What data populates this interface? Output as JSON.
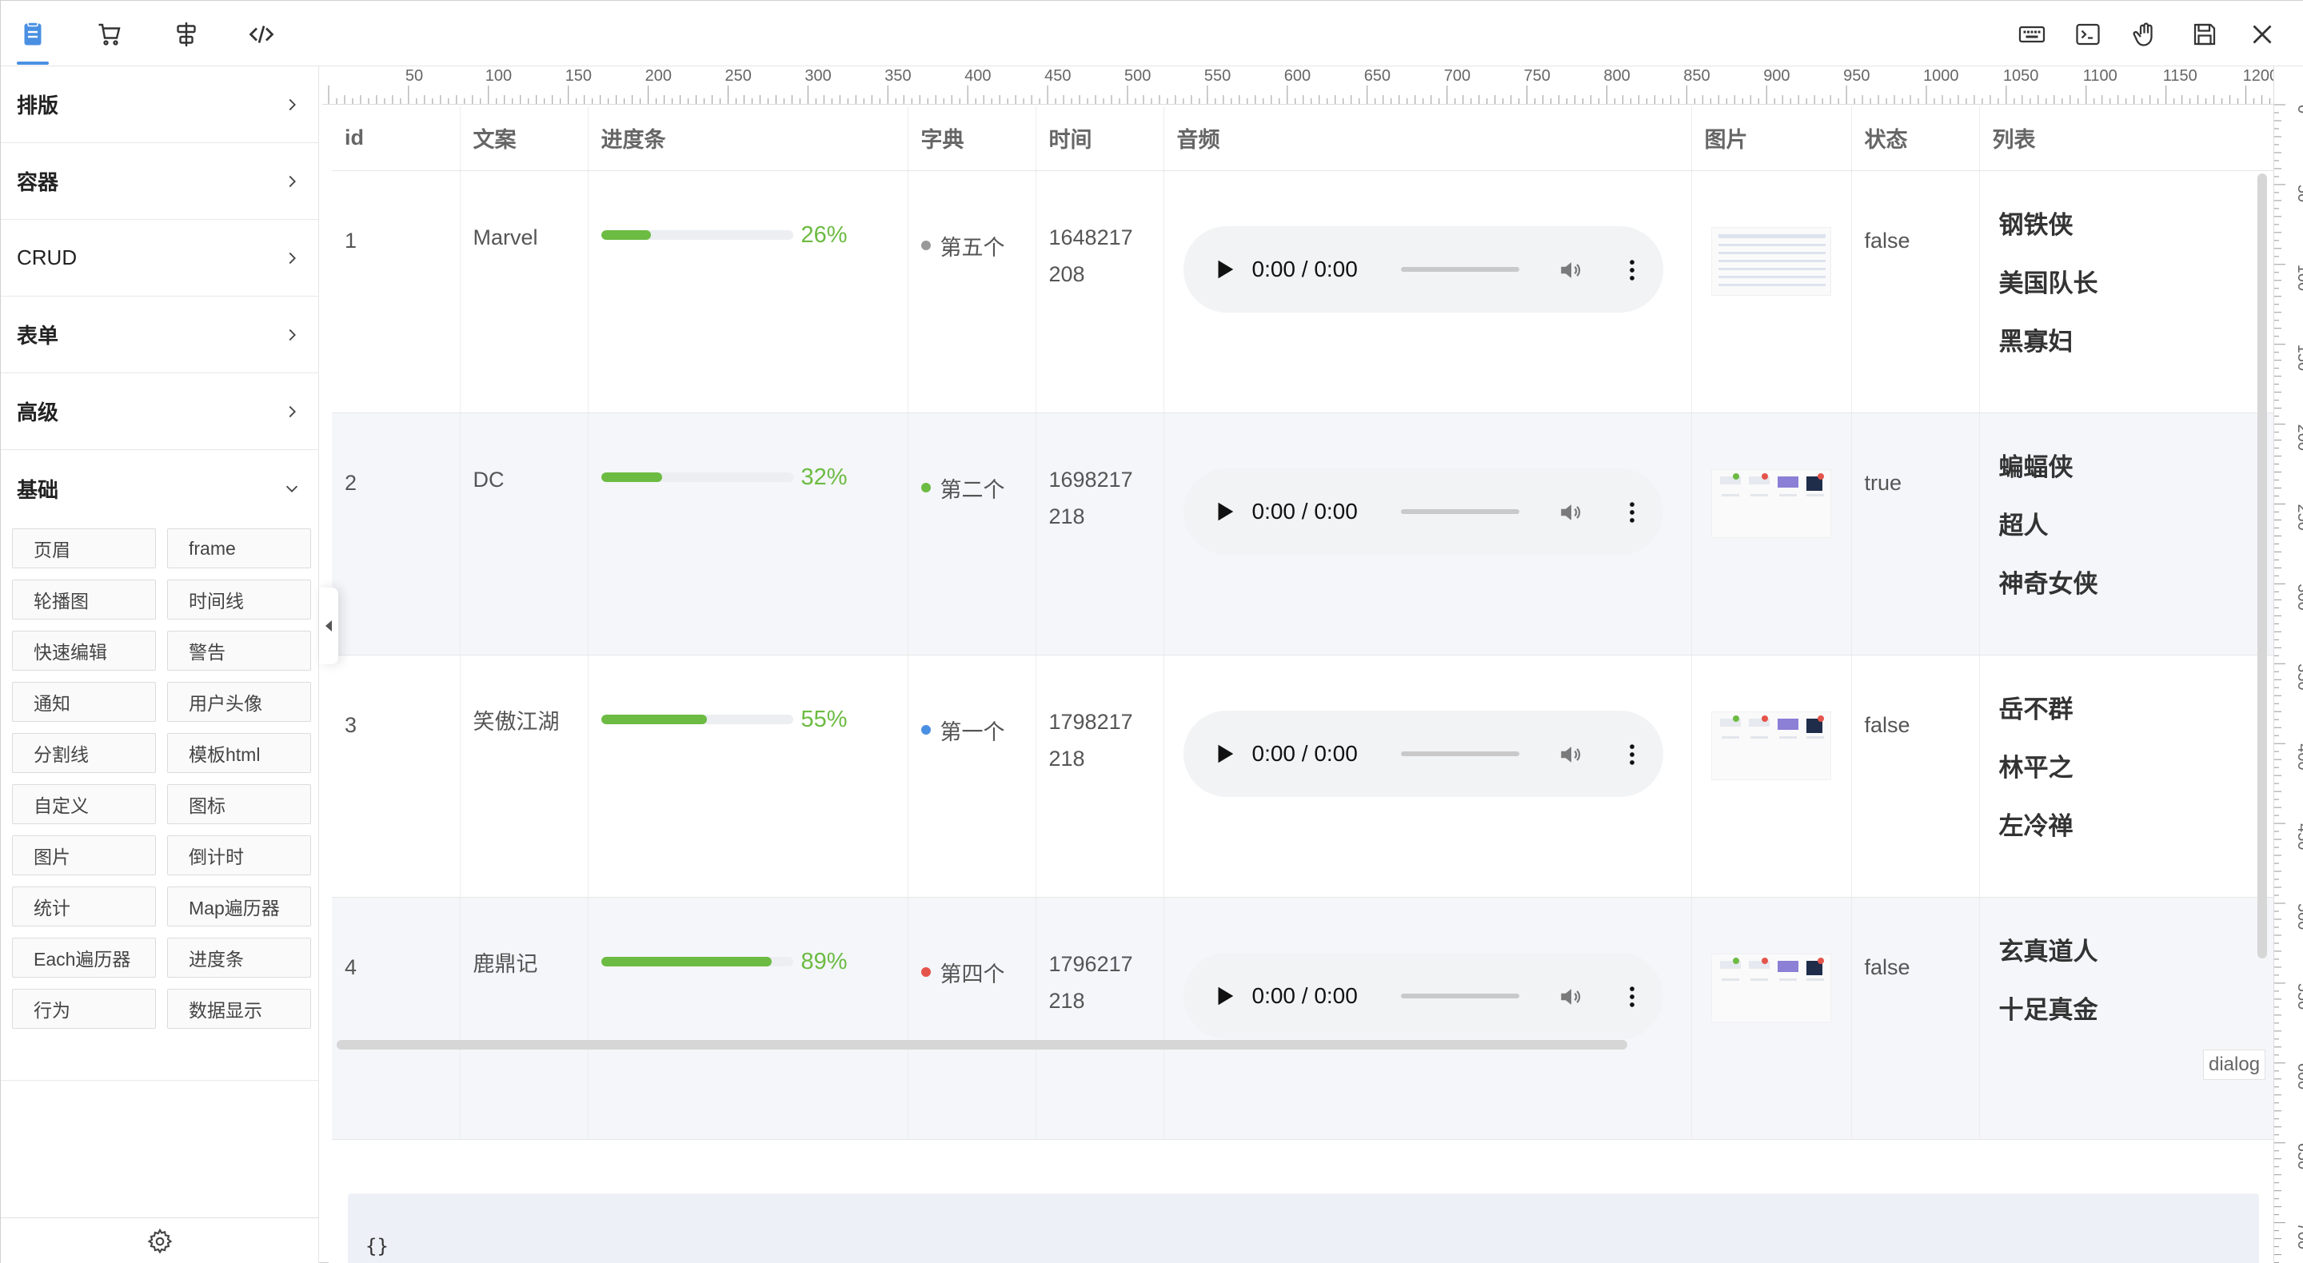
{
  "toolbar": {
    "left_icons": [
      "document-icon",
      "cart-icon",
      "layout-icon",
      "code-icon"
    ],
    "right_icons": [
      "keyboard-icon",
      "terminal-icon",
      "hand-icon",
      "save-icon",
      "close-icon"
    ],
    "accent": "#4a90e2"
  },
  "sidebar": {
    "categories": [
      {
        "label": "排版",
        "state": "collapsed"
      },
      {
        "label": "容器",
        "state": "collapsed"
      },
      {
        "label": "CRUD",
        "state": "collapsed"
      },
      {
        "label": "表单",
        "state": "collapsed"
      },
      {
        "label": "高级",
        "state": "collapsed"
      },
      {
        "label": "基础",
        "state": "expanded"
      }
    ],
    "components": [
      "页眉",
      "frame",
      "轮播图",
      "时间线",
      "快速编辑",
      "警告",
      "通知",
      "用户头像",
      "分割线",
      "模板html",
      "自定义",
      "图标",
      "图片",
      "倒计时",
      "统计",
      "Map遍历器",
      "Each遍历器",
      "进度条",
      "行为",
      "数据显示"
    ]
  },
  "ruler": {
    "top_labels": [
      "50",
      "100",
      "150",
      "200",
      "250",
      "300",
      "350",
      "400",
      "450",
      "500",
      "550",
      "600",
      "650",
      "700",
      "750",
      "800",
      "850",
      "900",
      "950",
      "1000",
      "1050",
      "1100",
      "1150",
      "1200"
    ],
    "right_labels": [
      "0",
      "50",
      "100",
      "150",
      "200",
      "250",
      "300",
      "350",
      "400",
      "450",
      "500",
      "550",
      "600",
      "650",
      "700"
    ]
  },
  "table": {
    "headers": [
      "id",
      "文案",
      "进度条",
      "字典",
      "时间",
      "音频",
      "图片",
      "状态",
      "列表"
    ],
    "rows": [
      {
        "id": "1",
        "text": "Marvel",
        "progress": 0.26,
        "progress_label": "26%",
        "dict": "第五个",
        "dict_color": "#999999",
        "time_a": "1648217",
        "time_b": "208",
        "audio": "0:00 / 0:00",
        "status": "false",
        "list": [
          "钢铁侠",
          "美国队长",
          "黑寡妇"
        ]
      },
      {
        "id": "2",
        "text": "DC",
        "progress": 0.32,
        "progress_label": "32%",
        "dict": "第二个",
        "dict_color": "#6cbb42",
        "time_a": "1698217",
        "time_b": "218",
        "audio": "0:00 / 0:00",
        "status": "true",
        "list": [
          "蝙蝠侠",
          "超人",
          "神奇女侠"
        ]
      },
      {
        "id": "3",
        "text": "笑傲江湖",
        "progress": 0.55,
        "progress_label": "55%",
        "dict": "第一个",
        "dict_color": "#4a90e2",
        "time_a": "1798217",
        "time_b": "218",
        "audio": "0:00 / 0:00",
        "status": "false",
        "list": [
          "岳不群",
          "林平之",
          "左冷禅"
        ]
      },
      {
        "id": "4",
        "text": "鹿鼎记",
        "progress": 0.89,
        "progress_label": "89%",
        "dict": "第四个",
        "dict_color": "#e5544b",
        "time_a": "1796217",
        "time_b": "218",
        "audio": "0:00 / 0:00",
        "status": "false",
        "list": [
          "玄真道人",
          "十足真金"
        ]
      }
    ]
  },
  "dialog_label": "dialog",
  "code_preview": "{}"
}
